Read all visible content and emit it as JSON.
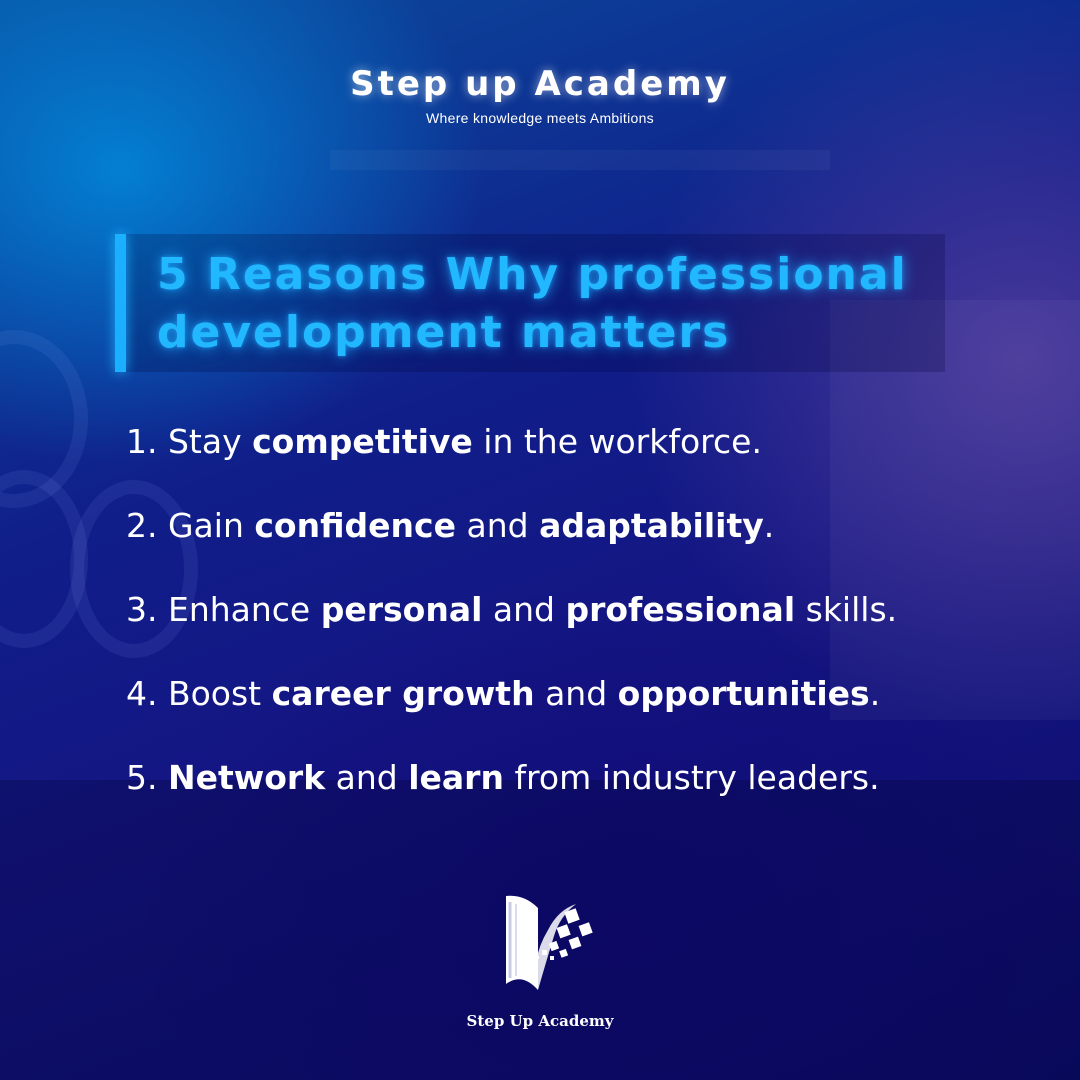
{
  "brand": {
    "title": "Step up Academy",
    "tagline": "Where knowledge meets Ambitions"
  },
  "headline": {
    "line1": "5 Reasons Why professional",
    "line2": "development matters",
    "color": "#22b8ff",
    "accent_bar_color": "#1bb0ff"
  },
  "reasons": [
    [
      {
        "t": "1. Stay ",
        "b": false
      },
      {
        "t": "competitive",
        "b": true
      },
      {
        "t": " in the workforce.",
        "b": false
      }
    ],
    [
      {
        "t": "2. Gain ",
        "b": false
      },
      {
        "t": "confidence",
        "b": true
      },
      {
        "t": " and ",
        "b": false
      },
      {
        "t": "adaptability",
        "b": true
      },
      {
        "t": ".",
        "b": false
      }
    ],
    [
      {
        "t": "3. Enhance ",
        "b": false
      },
      {
        "t": "personal",
        "b": true
      },
      {
        "t": " and ",
        "b": false
      },
      {
        "t": "professional",
        "b": true
      },
      {
        "t": " skills.",
        "b": false
      }
    ],
    [
      {
        "t": "4. Boost ",
        "b": false
      },
      {
        "t": "career growth",
        "b": true
      },
      {
        "t": " and ",
        "b": false
      },
      {
        "t": "opportunities",
        "b": true
      },
      {
        "t": ".",
        "b": false
      }
    ],
    [
      {
        "t": "5. ",
        "b": false
      },
      {
        "t": "Network",
        "b": true
      },
      {
        "t": " and ",
        "b": false
      },
      {
        "t": "learn",
        "b": true
      },
      {
        "t": " from industry leaders.",
        "b": false
      }
    ]
  ],
  "logo": {
    "icon": "book-pixels-logo-icon",
    "name": "Step Up Academy"
  },
  "colors": {
    "background_top": "#0a4d9e",
    "background_bottom": "#0d0c6b",
    "text": "#ffffff"
  }
}
